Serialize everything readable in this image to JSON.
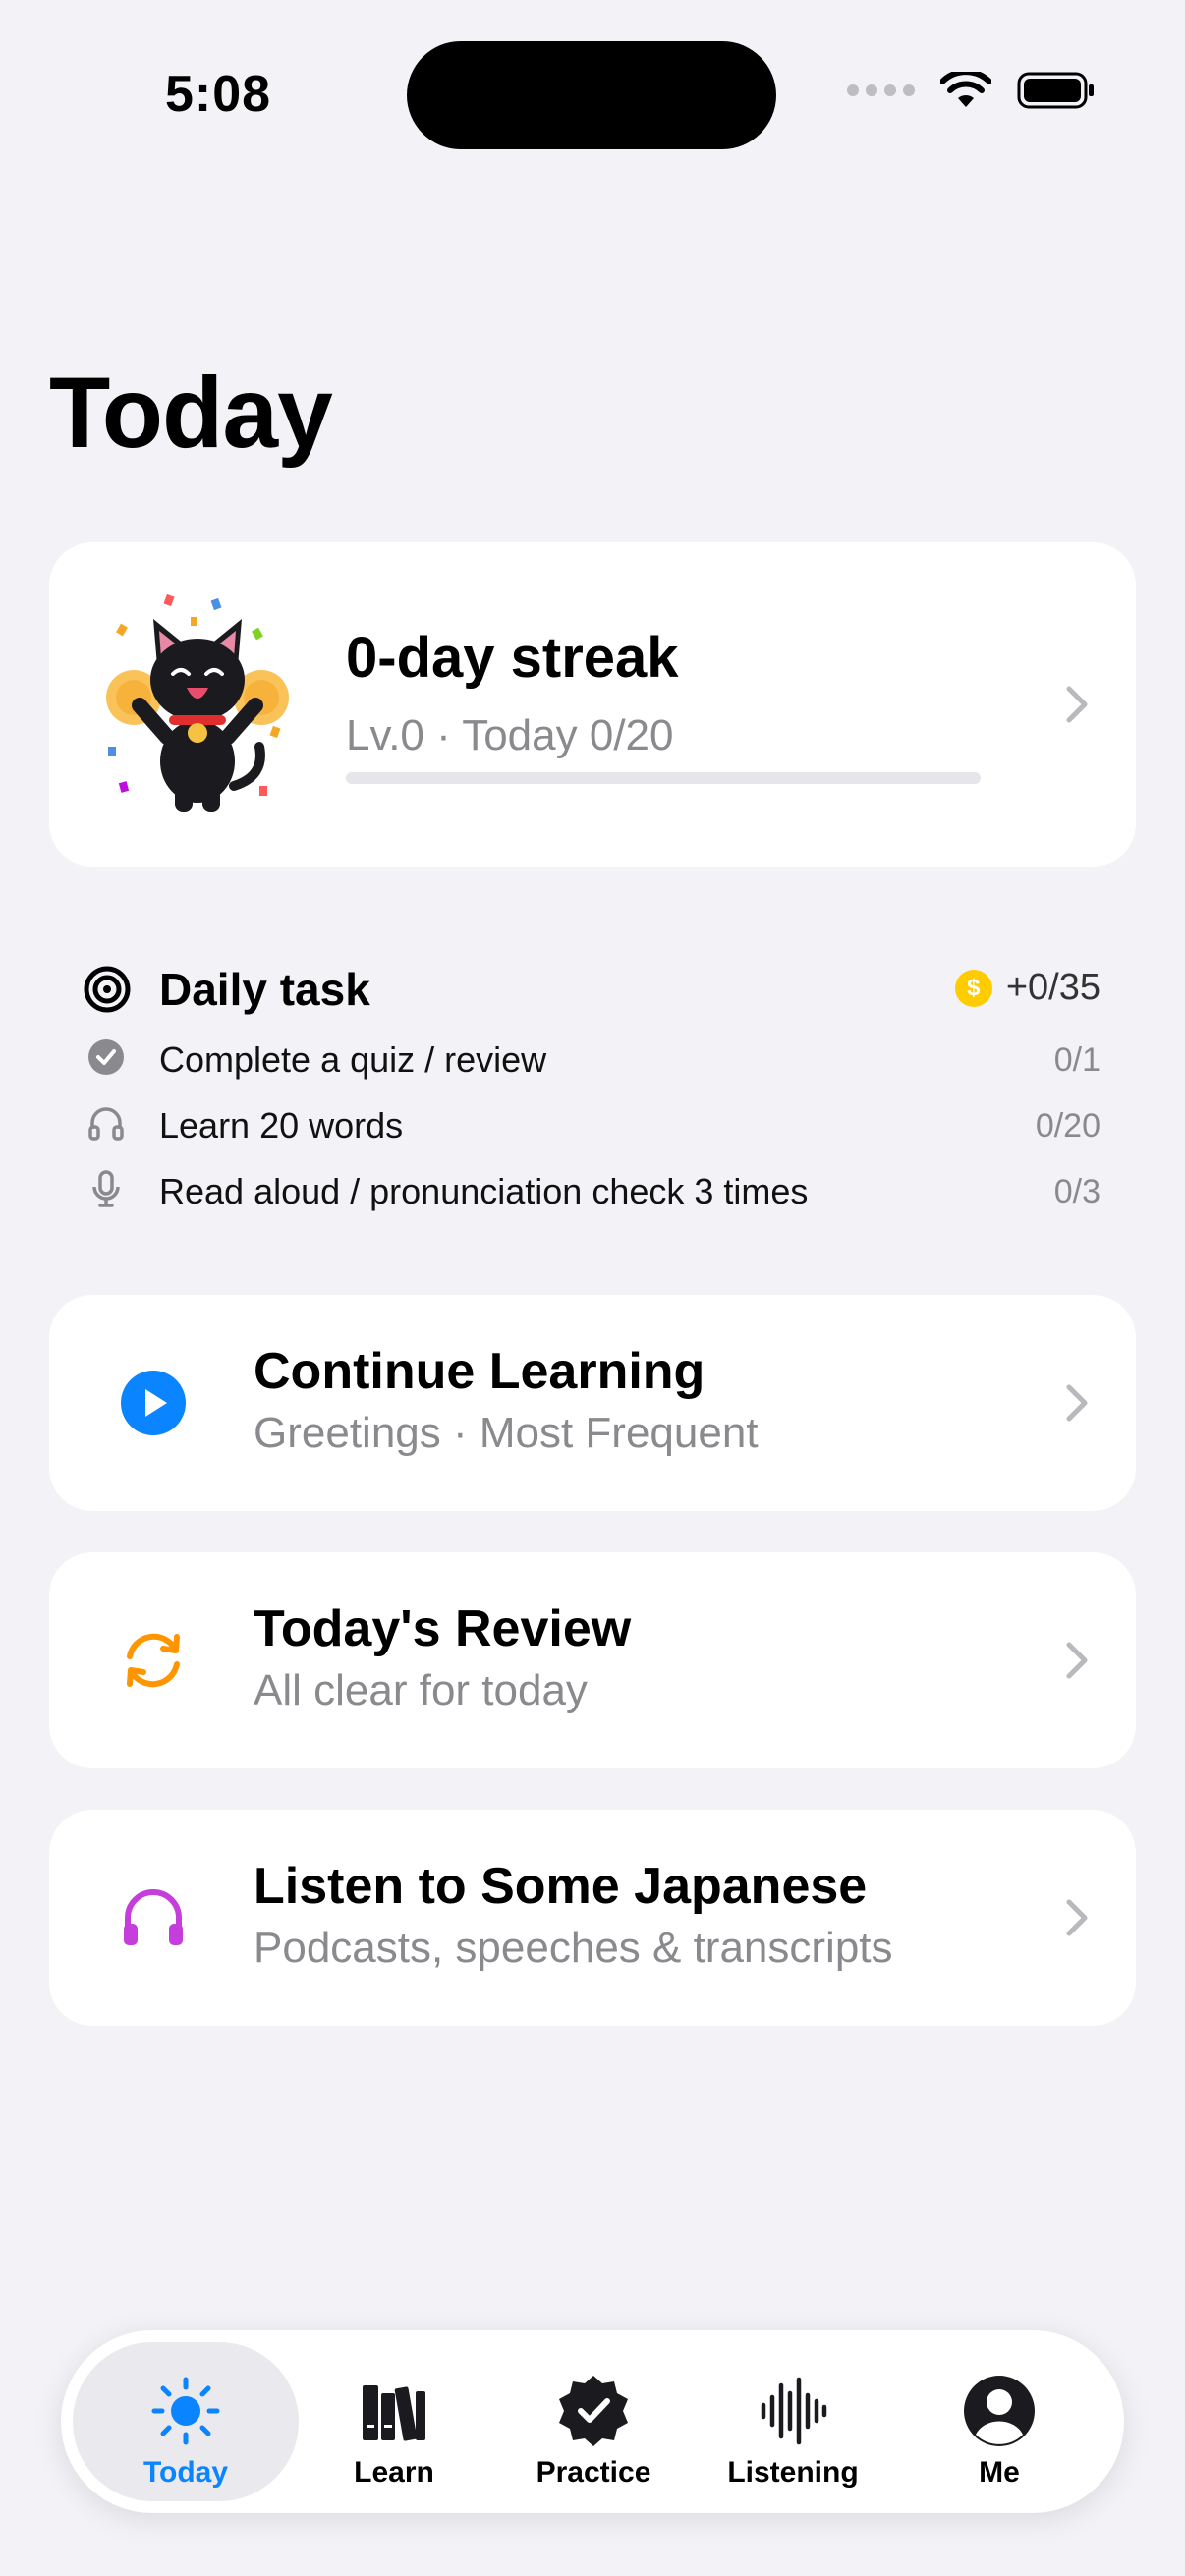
{
  "status_bar": {
    "time": "5:08"
  },
  "title": "Today",
  "streak": {
    "title": "0-day streak",
    "subtitle": "Lv.0 · Today 0/20",
    "progress": 0
  },
  "daily_task": {
    "title": "Daily task",
    "reward": "+0/35",
    "coin_symbol": "$",
    "items": [
      {
        "label": "Complete a quiz / review",
        "count": "0/1",
        "icon": "checkmark-circle-icon"
      },
      {
        "label": "Learn 20 words",
        "count": "0/20",
        "icon": "headphones-icon"
      },
      {
        "label": "Read aloud / pronunciation check 3 times",
        "count": "0/3",
        "icon": "microphone-icon"
      }
    ]
  },
  "actions": [
    {
      "title": "Continue Learning",
      "subtitle": "Greetings · Most Frequent",
      "icon": "play-circle-icon",
      "color": "#0a84ff"
    },
    {
      "title": "Today's Review",
      "subtitle": "All clear for today",
      "icon": "refresh-icon",
      "color": "#ff9500"
    },
    {
      "title": "Listen to Some Japanese",
      "subtitle": "Podcasts, speeches & transcripts",
      "icon": "headphones-icon",
      "color": "#c53edb"
    }
  ],
  "tabs": [
    {
      "label": "Today",
      "icon": "sun-icon",
      "active": true
    },
    {
      "label": "Learn",
      "icon": "books-icon",
      "active": false
    },
    {
      "label": "Practice",
      "icon": "checkmark-seal-icon",
      "active": false
    },
    {
      "label": "Listening",
      "icon": "waveform-icon",
      "active": false
    },
    {
      "label": "Me",
      "icon": "person-circle-icon",
      "active": false
    }
  ],
  "colors": {
    "accent": "#0a84ff",
    "background": "#f2f2f7",
    "coin": "#ffcc00"
  }
}
